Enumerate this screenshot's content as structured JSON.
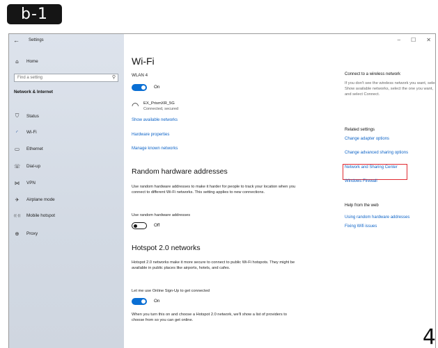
{
  "badge": "b-1",
  "page_number": "4",
  "window": {
    "title": "Settings",
    "controls": [
      "–",
      "☐",
      "✕"
    ]
  },
  "sidebar": {
    "home": "Home",
    "search_placeholder": "Find a setting",
    "section": "Network & Internet",
    "items": [
      {
        "label": "Status",
        "icon": "⛉"
      },
      {
        "label": "Wi-Fi",
        "icon": "◜"
      },
      {
        "label": "Ethernet",
        "icon": "▭"
      },
      {
        "label": "Dial-up",
        "icon": "☏"
      },
      {
        "label": "VPN",
        "icon": "⋈"
      },
      {
        "label": "Airplane mode",
        "icon": "✈"
      },
      {
        "label": "Mobile hotspot",
        "icon": "((·))"
      },
      {
        "label": "Proxy",
        "icon": "⊕"
      }
    ]
  },
  "main": {
    "title": "Wi-Fi",
    "wlan_label": "WLAN 4",
    "wlan_state": "On",
    "network_name": "EX_PrismXR_5G",
    "network_status": "Connected, secured",
    "links": [
      "Show available networks",
      "Hardware properties",
      "Manage known networks"
    ],
    "random_title": "Random hardware addresses",
    "random_desc": "Use random hardware addresses to make it harder for people to track your location when you connect to different Wi-Fi networks. This setting applies to new connections.",
    "random_label": "Use random hardware addresses",
    "random_state": "Off",
    "hotspot_title": "Hotspot 2.0 networks",
    "hotspot_desc": "Hotspot 2.0 networks make it more secure to connect to public Wi-Fi hotspots. They might be available in public places like airports, hotels, and cafes.",
    "signup_label": "Let me use Online Sign-Up to get connected",
    "signup_state": "On",
    "signup_desc": "When you turn this on and choose a Hotspot 2.0 network, we'll show a list of providers to choose from so you can get online."
  },
  "right": {
    "connect_title": "Connect to a wireless network",
    "connect_desc": "If you don't see the wireless network you want, select Show available networks, select the one you want, and select Connect.",
    "related_title": "Related settings",
    "related_links": [
      "Change adapter options",
      "Change advanced sharing options",
      "Network and Sharing Center",
      "Windows Firewall"
    ],
    "help_title": "Help from the web",
    "help_links": [
      "Using random hardware addresses",
      "Fixing Wifi issues"
    ]
  },
  "colors": {
    "accent": "#0a6fd4",
    "link": "#0c63c7",
    "highlight": "#e0292f",
    "sidebar": "#d3dae4"
  }
}
